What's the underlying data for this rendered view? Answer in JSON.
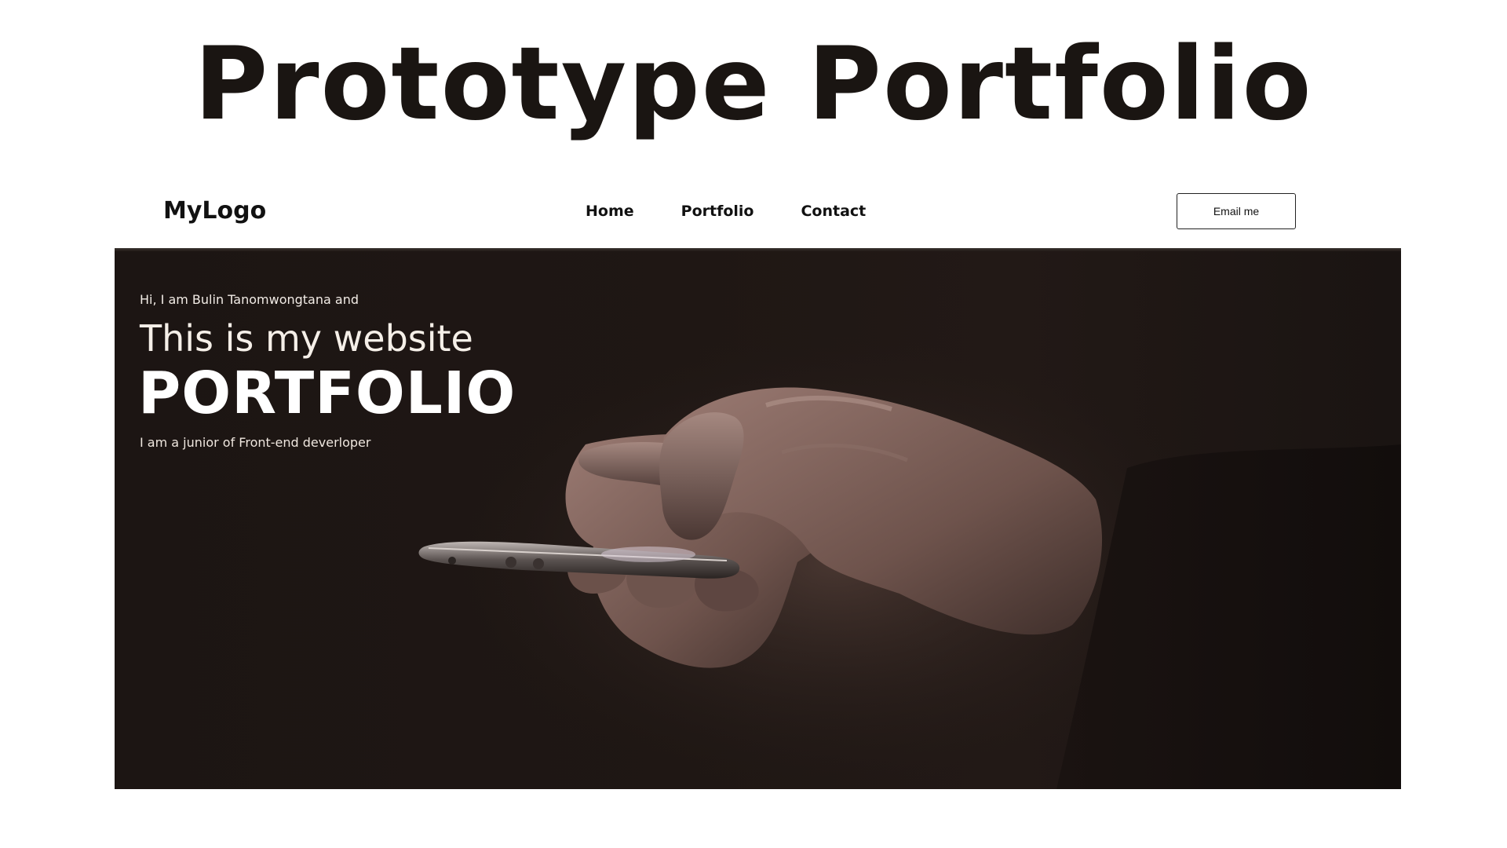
{
  "page": {
    "title": "Prototype Portfolio"
  },
  "navbar": {
    "logo": "MyLogo",
    "links": [
      {
        "label": "Home"
      },
      {
        "label": "Portfolio"
      },
      {
        "label": "Contact"
      }
    ],
    "email_button": "Email me"
  },
  "hero": {
    "intro": "Hi, I am Bulin Tanomwongtana and",
    "heading": "This is my website",
    "title": "PORTFOLIO",
    "subtitle": "I am a junior of Front-end deverloper",
    "image": "hands-holding-smartphone-dark-photo"
  },
  "colors": {
    "hero_background": "#1f1714",
    "text_light": "#ffffff",
    "text_dark": "#111111"
  }
}
